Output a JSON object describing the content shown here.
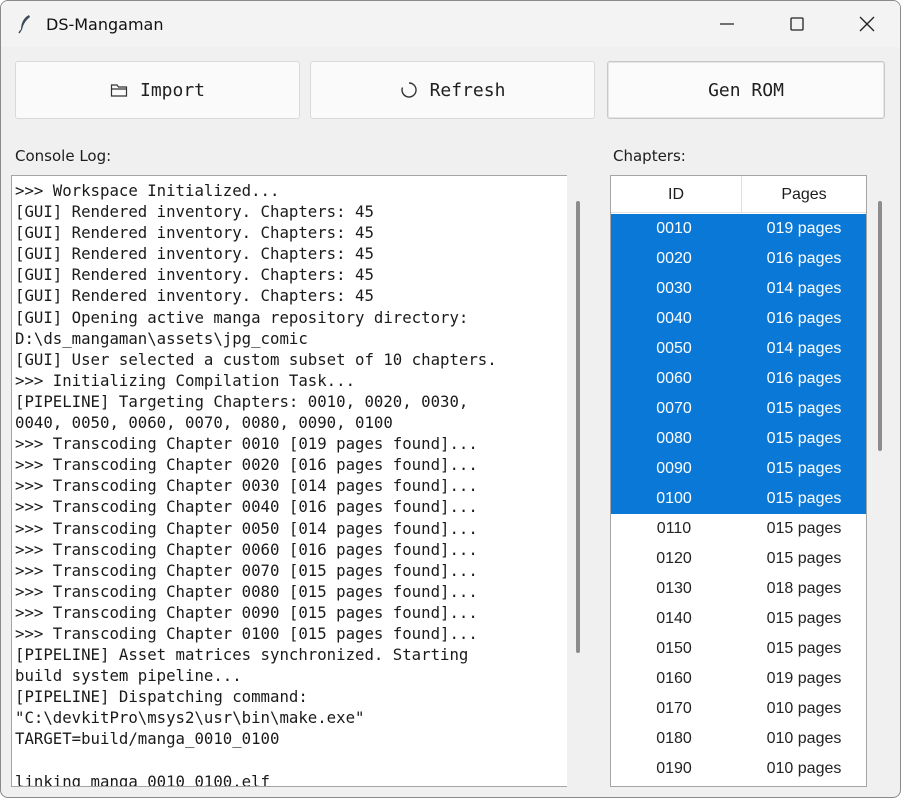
{
  "window": {
    "title": "DS-Mangaman",
    "icon": "feather-icon",
    "controls": [
      "minimize-icon",
      "maximize-icon",
      "close-icon"
    ]
  },
  "toolbar": {
    "import_label": "Import",
    "import_icon": "folder-icon",
    "refresh_label": "Refresh",
    "refresh_icon": "refresh-icon",
    "genrom_label": "Gen ROM"
  },
  "console": {
    "label": "Console Log:",
    "lines": [
      ">>> Workspace Initialized...",
      "[GUI] Rendered inventory. Chapters: 45",
      "[GUI] Rendered inventory. Chapters: 45",
      "[GUI] Rendered inventory. Chapters: 45",
      "[GUI] Rendered inventory. Chapters: 45",
      "[GUI] Rendered inventory. Chapters: 45",
      "[GUI] Opening active manga repository directory:",
      "D:\\ds_mangaman\\assets\\jpg_comic",
      "[GUI] User selected a custom subset of 10 chapters.",
      ">>> Initializing Compilation Task...",
      "[PIPELINE] Targeting Chapters: 0010, 0020, 0030,",
      "0040, 0050, 0060, 0070, 0080, 0090, 0100",
      ">>> Transcoding Chapter 0010 [019 pages found]...",
      ">>> Transcoding Chapter 0020 [016 pages found]...",
      ">>> Transcoding Chapter 0030 [014 pages found]...",
      ">>> Transcoding Chapter 0040 [016 pages found]...",
      ">>> Transcoding Chapter 0050 [014 pages found]...",
      ">>> Transcoding Chapter 0060 [016 pages found]...",
      ">>> Transcoding Chapter 0070 [015 pages found]...",
      ">>> Transcoding Chapter 0080 [015 pages found]...",
      ">>> Transcoding Chapter 0090 [015 pages found]...",
      ">>> Transcoding Chapter 0100 [015 pages found]...",
      "[PIPELINE] Asset matrices synchronized. Starting",
      "build system pipeline...",
      "[PIPELINE] Dispatching command:",
      "\"C:\\devkitPro\\msys2\\usr\\bin\\make.exe\"",
      "TARGET=build/manga_0010_0100",
      "",
      "linking manga_0010_0100.elf"
    ]
  },
  "chapters": {
    "label": "Chapters:",
    "columns": [
      "ID",
      "Pages"
    ],
    "selection_color": "#0a78d7",
    "rows": [
      {
        "id": "0010",
        "pages": "019 pages",
        "selected": true
      },
      {
        "id": "0020",
        "pages": "016 pages",
        "selected": true
      },
      {
        "id": "0030",
        "pages": "014 pages",
        "selected": true
      },
      {
        "id": "0040",
        "pages": "016 pages",
        "selected": true
      },
      {
        "id": "0050",
        "pages": "014 pages",
        "selected": true
      },
      {
        "id": "0060",
        "pages": "016 pages",
        "selected": true
      },
      {
        "id": "0070",
        "pages": "015 pages",
        "selected": true
      },
      {
        "id": "0080",
        "pages": "015 pages",
        "selected": true
      },
      {
        "id": "0090",
        "pages": "015 pages",
        "selected": true
      },
      {
        "id": "0100",
        "pages": "015 pages",
        "selected": true
      },
      {
        "id": "0110",
        "pages": "015 pages",
        "selected": false
      },
      {
        "id": "0120",
        "pages": "015 pages",
        "selected": false
      },
      {
        "id": "0130",
        "pages": "018 pages",
        "selected": false
      },
      {
        "id": "0140",
        "pages": "015 pages",
        "selected": false
      },
      {
        "id": "0150",
        "pages": "015 pages",
        "selected": false
      },
      {
        "id": "0160",
        "pages": "019 pages",
        "selected": false
      },
      {
        "id": "0170",
        "pages": "010 pages",
        "selected": false
      },
      {
        "id": "0180",
        "pages": "010 pages",
        "selected": false
      },
      {
        "id": "0190",
        "pages": "010 pages",
        "selected": false
      }
    ]
  }
}
